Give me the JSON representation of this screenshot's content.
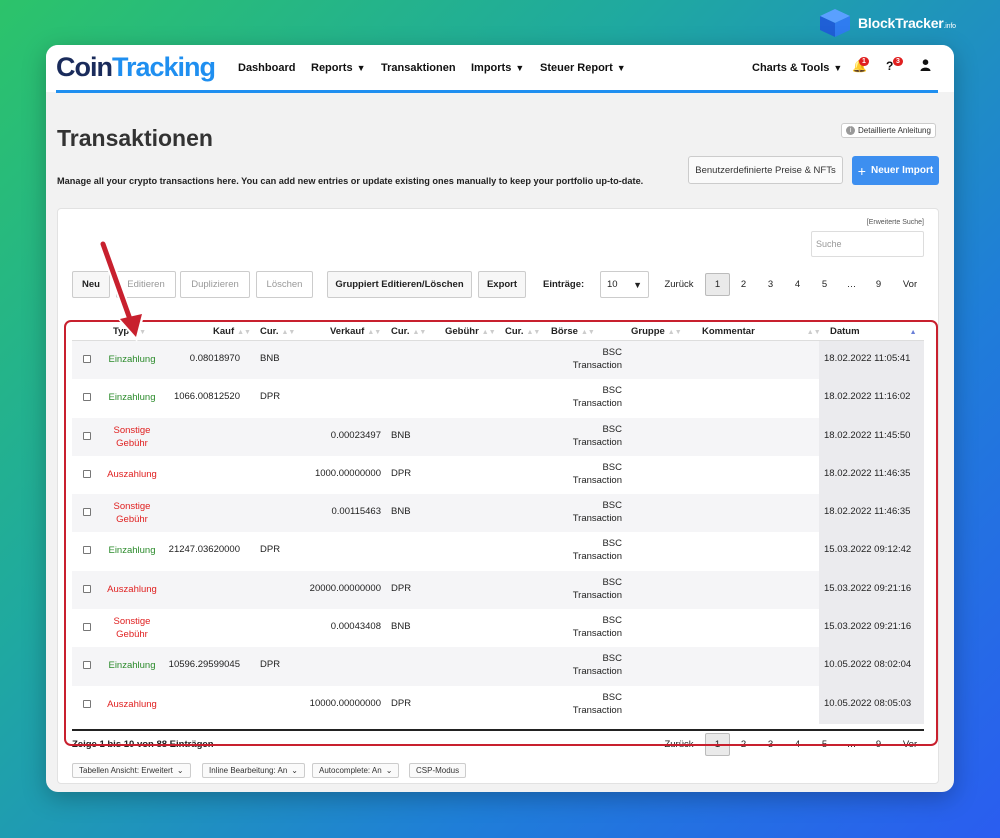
{
  "blocktracker": {
    "name": "BlockTracker",
    "suffix": ".info"
  },
  "brand": {
    "part1": "Coin",
    "part2": "Tracking"
  },
  "nav": {
    "dashboard": "Dashboard",
    "reports": "Reports",
    "transaktionen": "Transaktionen",
    "imports": "Imports",
    "steuer": "Steuer Report",
    "charts": "Charts & Tools",
    "bell_count": "1",
    "help_count": "3"
  },
  "page": {
    "title": "Transaktionen",
    "description": "Manage all your crypto transactions here. You can add new entries or update existing ones manually to keep your portfolio up-to-date.",
    "help": "Detaillierte Anleitung",
    "prices_button": "Benutzerdefinierte Preise & NFTs",
    "import_button": "Neuer Import"
  },
  "panel": {
    "advanced_search": "[Erweiterte Suche]",
    "search_placeholder": "Suche",
    "toolbar": {
      "neu": "Neu",
      "edit": "Editieren",
      "dup": "Duplizieren",
      "del": "Löschen",
      "group": "Gruppiert Editieren/Löschen",
      "export": "Export"
    },
    "entries_label": "Einträge:",
    "entries_value": "10",
    "pagination": {
      "prev": "Zurück",
      "pages": [
        "1",
        "2",
        "3",
        "4",
        "5",
        "…",
        "9"
      ],
      "next": "Vor"
    }
  },
  "columns": {
    "typ": "Typ",
    "kauf": "Kauf",
    "cur1": "Cur.",
    "verkauf": "Verkauf",
    "cur2": "Cur.",
    "gebuehr": "Gebühr",
    "cur3": "Cur.",
    "boerse": "Börse",
    "gruppe": "Gruppe",
    "kommentar": "Kommentar",
    "datum": "Datum"
  },
  "rows": [
    {
      "typ": "Einzahlung",
      "kind": "in",
      "kauf": "0.08018970",
      "cur1": "BNB",
      "verkauf": "",
      "cur2": "",
      "boerse1": "BSC",
      "boerse2": "Transaction",
      "datum": "18.02.2022 11:05:41"
    },
    {
      "typ": "Einzahlung",
      "kind": "in",
      "kauf": "1066.00812520",
      "cur1": "DPR",
      "verkauf": "",
      "cur2": "",
      "boerse1": "BSC",
      "boerse2": "Transaction",
      "datum": "18.02.2022 11:16:02"
    },
    {
      "typ": "Sonstige Gebühr",
      "typ1": "Sonstige",
      "typ2": "Gebühr",
      "kind": "out",
      "kauf": "",
      "cur1": "",
      "verkauf": "0.00023497",
      "cur2": "BNB",
      "boerse1": "BSC",
      "boerse2": "Transaction",
      "datum": "18.02.2022 11:45:50"
    },
    {
      "typ": "Auszahlung",
      "kind": "out",
      "kauf": "",
      "cur1": "",
      "verkauf": "1000.00000000",
      "cur2": "DPR",
      "boerse1": "BSC",
      "boerse2": "Transaction",
      "datum": "18.02.2022 11:46:35"
    },
    {
      "typ": "Sonstige Gebühr",
      "typ1": "Sonstige",
      "typ2": "Gebühr",
      "kind": "out",
      "kauf": "",
      "cur1": "",
      "verkauf": "0.00115463",
      "cur2": "BNB",
      "boerse1": "BSC",
      "boerse2": "Transaction",
      "datum": "18.02.2022 11:46:35"
    },
    {
      "typ": "Einzahlung",
      "kind": "in",
      "kauf": "21247.03620000",
      "cur1": "DPR",
      "verkauf": "",
      "cur2": "",
      "boerse1": "BSC",
      "boerse2": "Transaction",
      "datum": "15.03.2022 09:12:42"
    },
    {
      "typ": "Auszahlung",
      "kind": "out",
      "kauf": "",
      "cur1": "",
      "verkauf": "20000.00000000",
      "cur2": "DPR",
      "boerse1": "BSC",
      "boerse2": "Transaction",
      "datum": "15.03.2022 09:21:16"
    },
    {
      "typ": "Sonstige Gebühr",
      "typ1": "Sonstige",
      "typ2": "Gebühr",
      "kind": "out",
      "kauf": "",
      "cur1": "",
      "verkauf": "0.00043408",
      "cur2": "BNB",
      "boerse1": "BSC",
      "boerse2": "Transaction",
      "datum": "15.03.2022 09:21:16"
    },
    {
      "typ": "Einzahlung",
      "kind": "in",
      "kauf": "10596.29599045",
      "cur1": "DPR",
      "verkauf": "",
      "cur2": "",
      "boerse1": "BSC",
      "boerse2": "Transaction",
      "datum": "10.05.2022 08:02:04"
    },
    {
      "typ": "Auszahlung",
      "kind": "out",
      "kauf": "",
      "cur1": "",
      "verkauf": "10000.00000000",
      "cur2": "DPR",
      "boerse1": "BSC",
      "boerse2": "Transaction",
      "datum": "10.05.2022 08:05:03"
    }
  ],
  "footer": {
    "summary": "Zeige 1 bis 10 von 88 Einträgen",
    "options": {
      "view": "Tabellen Ansicht: Erweitert",
      "inline": "Inline Bearbeitung: An",
      "autocomplete": "Autocomplete: An",
      "csp": "CSP-Modus"
    }
  },
  "colors": {
    "accent": "#1f8ff0",
    "deposit": "#2a8a2a",
    "withdrawal": "#e02020",
    "highlight": "#c8202e"
  }
}
